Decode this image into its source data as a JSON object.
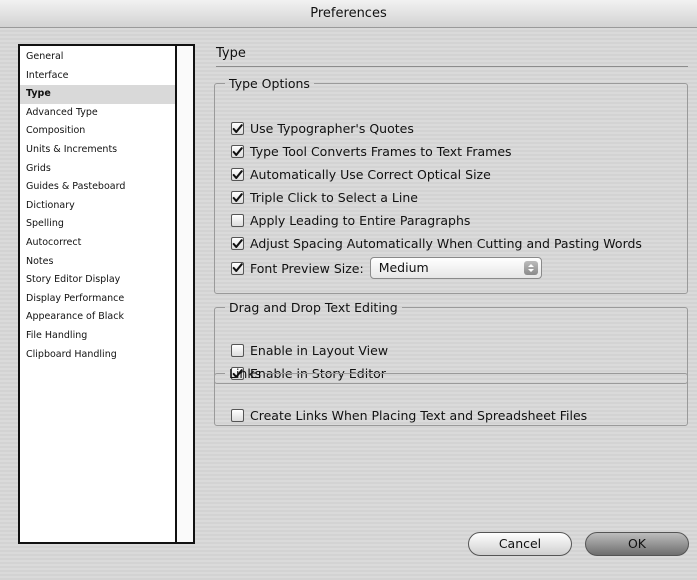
{
  "window": {
    "title": "Preferences"
  },
  "sidebar": {
    "items": [
      {
        "label": "General"
      },
      {
        "label": "Interface"
      },
      {
        "label": "Type"
      },
      {
        "label": "Advanced Type"
      },
      {
        "label": "Composition"
      },
      {
        "label": "Units & Increments"
      },
      {
        "label": "Grids"
      },
      {
        "label": "Guides & Pasteboard"
      },
      {
        "label": "Dictionary"
      },
      {
        "label": "Spelling"
      },
      {
        "label": "Autocorrect"
      },
      {
        "label": "Notes"
      },
      {
        "label": "Story Editor Display"
      },
      {
        "label": "Display Performance"
      },
      {
        "label": "Appearance of Black"
      },
      {
        "label": "File Handling"
      },
      {
        "label": "Clipboard Handling"
      }
    ],
    "selected": "Type"
  },
  "panel": {
    "title": "Type",
    "type_options": {
      "legend": "Type Options",
      "options": [
        {
          "label": "Use Typographer's Quotes",
          "checked": true
        },
        {
          "label": "Type Tool Converts Frames to Text Frames",
          "checked": true
        },
        {
          "label": "Automatically Use Correct Optical Size",
          "checked": true
        },
        {
          "label": "Triple Click to Select a Line",
          "checked": true
        },
        {
          "label": "Apply Leading to Entire Paragraphs",
          "checked": false
        },
        {
          "label": "Adjust Spacing Automatically When Cutting and Pasting Words",
          "checked": true
        },
        {
          "label": "Font Preview Size:",
          "checked": true
        }
      ],
      "font_preview_size": "Medium"
    },
    "drag_drop": {
      "legend": "Drag and Drop Text Editing",
      "options": [
        {
          "label": "Enable in Layout View",
          "checked": false
        },
        {
          "label": "Enable in Story Editor",
          "checked": true
        }
      ]
    },
    "links": {
      "legend": "Links",
      "options": [
        {
          "label": "Create Links When Placing Text and Spreadsheet Files",
          "checked": false
        }
      ]
    }
  },
  "buttons": {
    "cancel": "Cancel",
    "ok": "OK"
  }
}
